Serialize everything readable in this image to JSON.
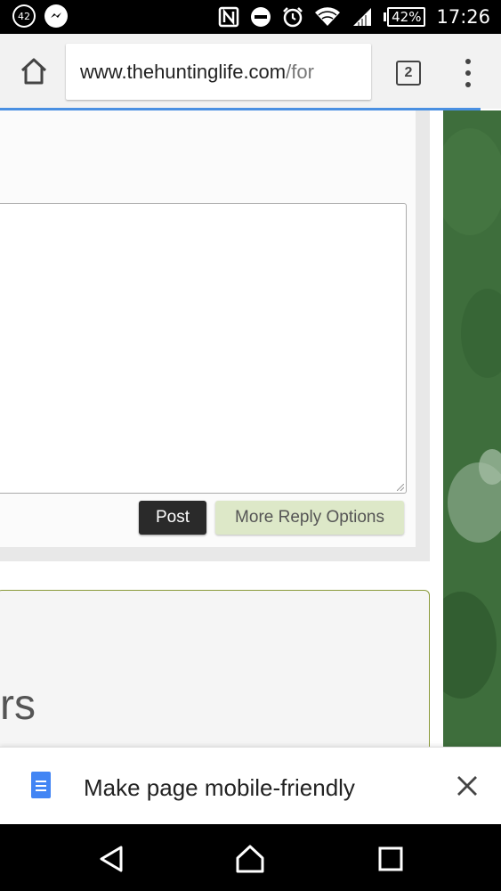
{
  "status_bar": {
    "notification_count": "42",
    "battery_percent": "42%",
    "time": "17:26",
    "icons": [
      "notification-count-icon",
      "messenger-icon",
      "nfc-icon",
      "do-not-disturb-icon",
      "alarm-icon",
      "wifi-icon",
      "cellular-signal-icon",
      "battery-icon"
    ]
  },
  "browser": {
    "url_main": "www.thehuntinglife.com",
    "url_tail": "/for",
    "tab_count": "2",
    "icons": [
      "home-icon",
      "more-vert-icon"
    ]
  },
  "reply": {
    "post_label": "Post",
    "more_options_label": "More Reply Options"
  },
  "section": {
    "partial_heading": "rs"
  },
  "infobar": {
    "message": "Make page mobile-friendly",
    "icons": [
      "document-icon",
      "close-icon"
    ]
  },
  "navbar": {
    "icons": [
      "back-icon",
      "home-nav-icon",
      "recents-icon"
    ]
  },
  "colors": {
    "accent": "#4a90e2",
    "post_button": "#2a2a2a",
    "more_options_button": "#dde8c8",
    "green_background": "#3e6e3c",
    "box_border": "#8a9a3a"
  }
}
